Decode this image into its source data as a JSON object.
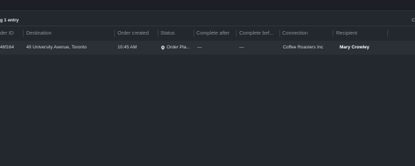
{
  "toolbar": {
    "entry_count": "g 1 entry",
    "right_label": "C"
  },
  "table": {
    "columns": [
      "der ID",
      "Destination",
      "Order created",
      "Status",
      "Complete after",
      "Complete bef...",
      "Connection",
      "Recipient"
    ],
    "rows": [
      {
        "order_id": "46f164",
        "destination": "40 University Avenue, Toronto",
        "order_created": "10:45 AM",
        "status": "Order Pla...",
        "complete_after": "—",
        "complete_before": "—",
        "connection": "Coffee Roasters Inc",
        "recipient": "Mary Crowley"
      }
    ]
  },
  "icons": {
    "status": "location-pin-icon"
  },
  "colors": {
    "background": "#23272e",
    "row_background": "#2b3037",
    "header_text": "#8c939b",
    "cell_text": "#d3d7dc"
  }
}
